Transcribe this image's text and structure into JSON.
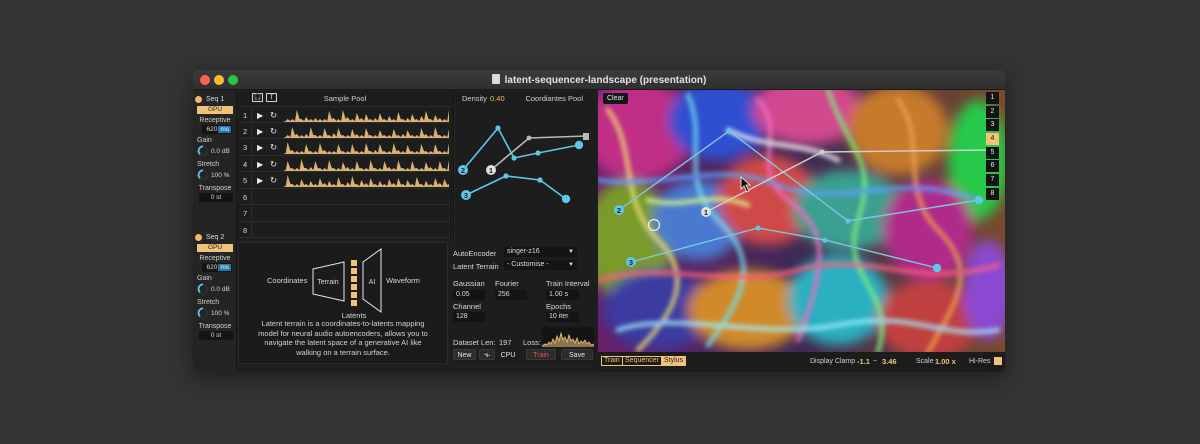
{
  "window": {
    "title": "latent-sequencer-landscape (presentation)"
  },
  "left_strip": {
    "seqs": [
      {
        "label": "Seq 1",
        "gpu": "GPU",
        "receptive_label": "Receptive",
        "receptive_value": "620",
        "receptive_unit": "ms",
        "gain_label": "Gain",
        "gain_value": "0.0 dB",
        "stretch_label": "Stretch",
        "stretch_value": "100 %",
        "transpose_label": "Transpose",
        "transpose_value": "0 st"
      },
      {
        "label": "Seq 2",
        "gpu": "GPU",
        "receptive_label": "Receptive",
        "receptive_value": "620",
        "receptive_unit": "ms",
        "gain_label": "Gain",
        "gain_value": "0.0 dB",
        "stretch_label": "Stretch",
        "stretch_value": "100 %",
        "transpose_label": "Transpose",
        "transpose_value": "0 st"
      }
    ]
  },
  "sample_pool": {
    "title": "Sample Pool",
    "header_icons": [
      "headphones-icon",
      "text-icon"
    ],
    "header_icon_glyphs": [
      "🎧",
      "T"
    ],
    "rows": [
      {
        "num": "1",
        "has_sample": true
      },
      {
        "num": "2",
        "has_sample": true
      },
      {
        "num": "3",
        "has_sample": true
      },
      {
        "num": "4",
        "has_sample": true
      },
      {
        "num": "5",
        "has_sample": true
      },
      {
        "num": "6",
        "has_sample": false
      },
      {
        "num": "7",
        "has_sample": false
      },
      {
        "num": "8",
        "has_sample": false
      }
    ],
    "play_glyph": "▶",
    "loop_glyph": "↻",
    "arrow_glyph": "›"
  },
  "coordinates_pool": {
    "density_label": "Density",
    "density_value": "0.40",
    "title": "Coordiantes Pool",
    "point_labels": [
      "2",
      "1",
      "3"
    ]
  },
  "info_panel": {
    "diagram": {
      "coordinates": "Coordinates",
      "terrain": "Terrain",
      "ai": "AI",
      "waveform": "Waveform",
      "latents": "Latents"
    },
    "description": "Latent terrain is a coordinates-to-latents mapping model for neural audio autoencoders, allows you to navigate the latent space of a generative AI like walking on a terrain surface."
  },
  "autoencoder_panel": {
    "autoencoder_label": "AutoEncoder",
    "autoencoder_value": "singer-z16",
    "latent_terrain_label": "Latent Terrain",
    "latent_terrain_value": "- Customise -",
    "gaussian_label": "Gaussian",
    "gaussian_value": "0.05",
    "fourier_label": "Fourier",
    "fourier_value": "256",
    "train_interval_label": "Train Interval",
    "train_interval_value": "1.00 s",
    "channel_label": "Channel",
    "channel_value": "128",
    "epochs_label": "Epochs",
    "epochs_value": "10 iter",
    "dataset_len_label": "Dataset Len:",
    "dataset_len_value": "197",
    "loss_label": "Loss:",
    "buttons": {
      "new": "New",
      "cpu": "CPU",
      "train": "Train",
      "save": "Save"
    }
  },
  "latent_terrain": {
    "clear_label": "Clear",
    "numbers": [
      "1",
      "2",
      "3",
      "4",
      "5",
      "6",
      "7",
      "8"
    ],
    "selected_number": "4",
    "point_labels": [
      "2",
      "1",
      "3"
    ],
    "footer": {
      "tags": [
        "Train",
        "Sequencer",
        "Stylus"
      ],
      "active_tag": "Stylus",
      "display_clamp_label": "Display Clamp",
      "display_clamp_min": "-1.1",
      "display_clamp_sep": "~",
      "display_clamp_max": "3.46",
      "scale_label": "Scale",
      "scale_value": "1.00 x",
      "hires_label": "Hi-Res",
      "hires_on": true
    }
  },
  "colors": {
    "accent": "#f0c27a",
    "cyan": "#5cc8e6",
    "train_red": "#e05a4a"
  }
}
